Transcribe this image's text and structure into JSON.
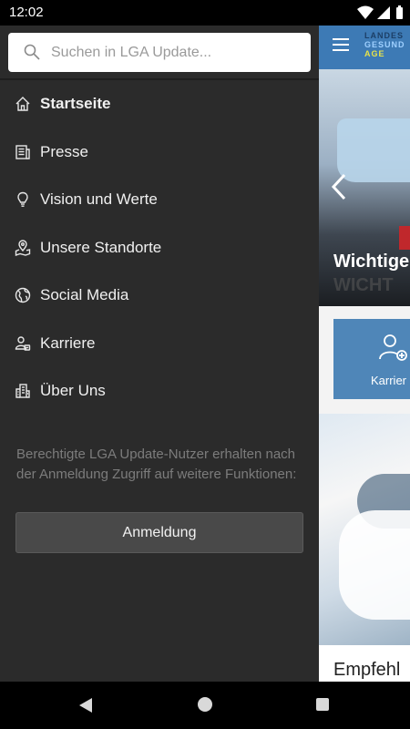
{
  "status_bar": {
    "time": "12:02"
  },
  "search": {
    "placeholder": "Suchen in LGA Update..."
  },
  "menu": {
    "items": [
      {
        "label": "Startseite",
        "icon": "home-icon"
      },
      {
        "label": "Presse",
        "icon": "newspaper-icon"
      },
      {
        "label": "Vision und Werte",
        "icon": "lightbulb-icon"
      },
      {
        "label": "Unsere Standorte",
        "icon": "map-pin-icon"
      },
      {
        "label": "Social Media",
        "icon": "globe-icon"
      },
      {
        "label": "Karriere",
        "icon": "person-badge-icon"
      },
      {
        "label": "Über Uns",
        "icon": "building-icon"
      }
    ]
  },
  "drawer": {
    "note": "Berechtigte LGA Update-Nutzer erhalten nach der Anmeldung Zugriff auf weitere Funktionen:",
    "login_label": "Anmeldung"
  },
  "background_app": {
    "logo_lines": [
      "LANDES",
      "GESUND",
      "AGE"
    ],
    "hero_title": "Wichtige",
    "hero_subtitle": "WICHT",
    "tile_label": "Karrier",
    "card_title": "Empfehl"
  },
  "colors": {
    "drawer_bg": "#2b2b2b",
    "header_blue": "#3d7ab5",
    "tile_blue": "#4f86b8"
  }
}
